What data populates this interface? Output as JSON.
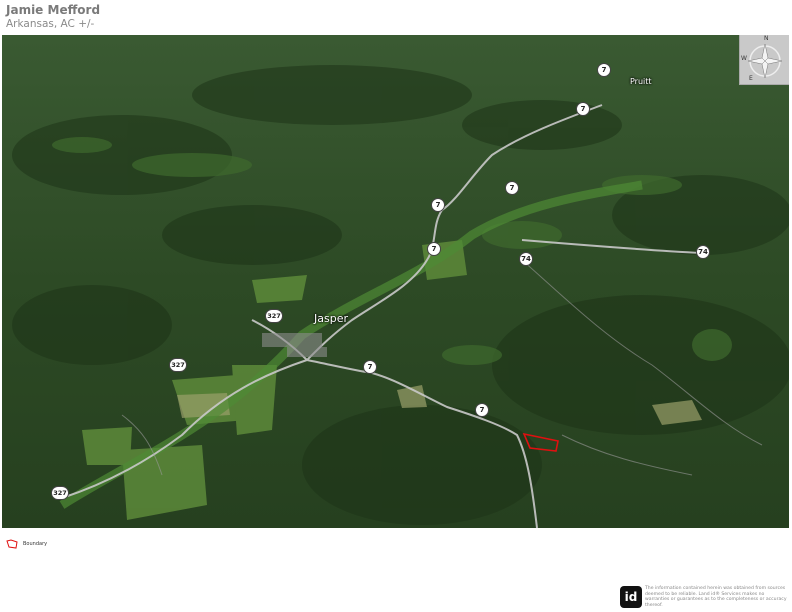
{
  "header": {
    "title": "Jamie Mefford",
    "subtitle": "Arkansas,  AC +/-"
  },
  "map": {
    "places": {
      "jasper": "Jasper",
      "pruitt": "Pruitt"
    },
    "road_labels": [
      "7",
      "7",
      "7",
      "7",
      "7",
      "7",
      "74",
      "74",
      "327",
      "327",
      "327",
      "7"
    ],
    "compass": {
      "n": "N",
      "e": "E",
      "w": "W",
      "icon": "compass-rose-icon"
    },
    "colors": {
      "boundary": "#e01010",
      "shield_bg": "#ffffff",
      "label": "#ffffff"
    }
  },
  "legend": {
    "label": "Boundary",
    "icon": "boundary-icon"
  },
  "footer": {
    "logo": "id",
    "disclaimer": "The information contained herein was obtained from sources deemed to be reliable. Land id® Services makes no warranties or guarantees as to the completeness or accuracy thereof."
  }
}
